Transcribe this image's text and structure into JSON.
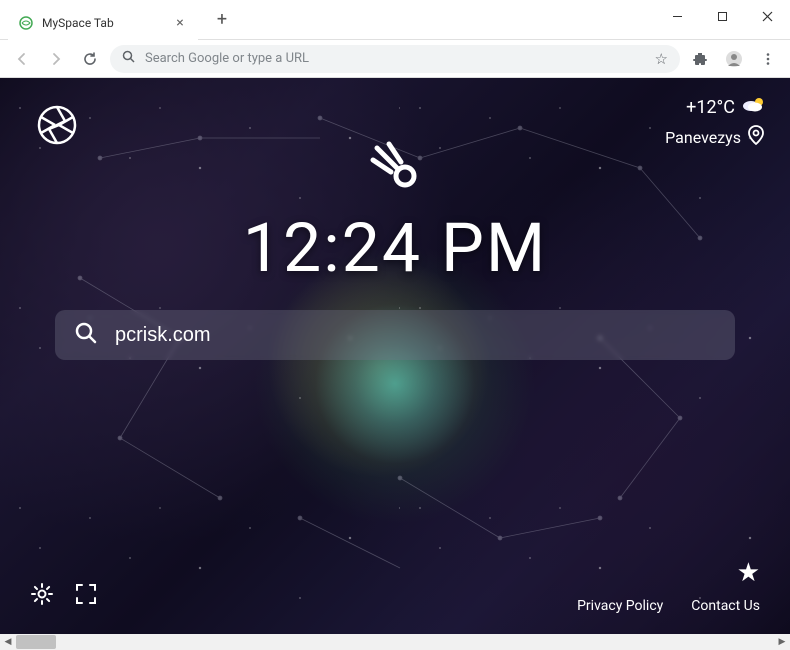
{
  "window": {
    "tab": {
      "title": "MySpace Tab"
    }
  },
  "toolbar": {
    "omnibox_placeholder": "Search Google or type a URL"
  },
  "weather": {
    "temp": "+12°C",
    "location": "Panevezys"
  },
  "clock": {
    "time": "12:24 PM"
  },
  "search": {
    "value": "pcrisk.com"
  },
  "footer": {
    "privacy": "Privacy Policy",
    "contact": "Contact Us"
  }
}
